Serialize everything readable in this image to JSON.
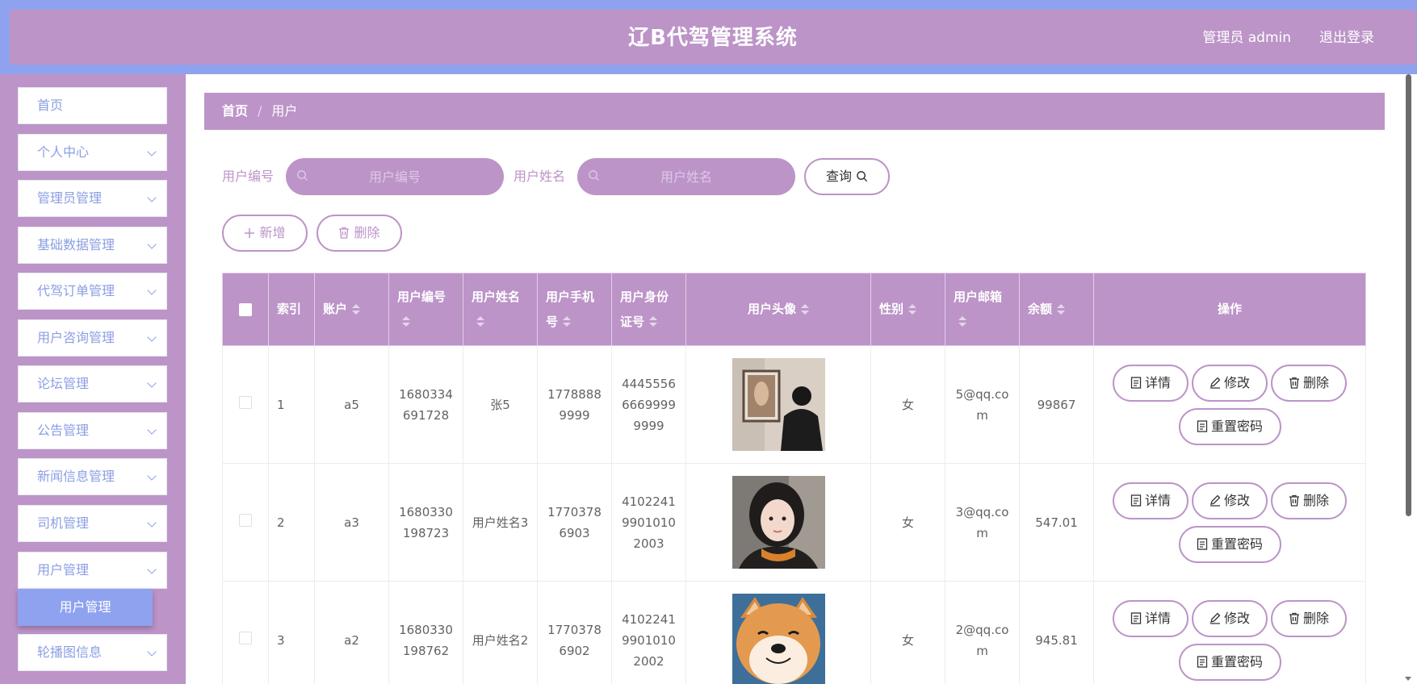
{
  "header": {
    "title": "辽B代驾管理系统",
    "user": "管理员 admin",
    "logout": "退出登录"
  },
  "sidebar": {
    "items": [
      {
        "label": "首页"
      },
      {
        "label": "个人中心"
      },
      {
        "label": "管理员管理"
      },
      {
        "label": "基础数据管理"
      },
      {
        "label": "代驾订单管理"
      },
      {
        "label": "用户咨询管理"
      },
      {
        "label": "论坛管理"
      },
      {
        "label": "公告管理"
      },
      {
        "label": "新闻信息管理"
      },
      {
        "label": "司机管理"
      },
      {
        "label": "用户管理"
      },
      {
        "label": "轮播图信息"
      }
    ],
    "active_sub": "用户管理"
  },
  "breadcrumb": {
    "home": "首页",
    "sep": "/",
    "current": "用户"
  },
  "filters": {
    "user_no_label": "用户编号",
    "user_no_placeholder": "用户编号",
    "user_name_label": "用户姓名",
    "user_name_placeholder": "用户姓名",
    "query": "查询"
  },
  "actions": {
    "add": "新增",
    "delete": "删除"
  },
  "table": {
    "headers": {
      "index": "索引",
      "account": "账户",
      "user_no": "用户编号",
      "name": "用户姓名",
      "phone": "用户手机号",
      "id_card": "用户身份证号",
      "avatar": "用户头像",
      "gender": "性别",
      "email": "用户邮箱",
      "balance": "余额",
      "ops": "操作"
    },
    "rows": [
      {
        "index": "1",
        "account": "a5",
        "user_no": "1680334691728",
        "name": "张5",
        "phone": "17788889999",
        "id_card": "444555666699999999",
        "gender": "女",
        "email": "5@qq.com",
        "balance": "99867",
        "avatar_icon": "photo-person-back"
      },
      {
        "index": "2",
        "account": "a3",
        "user_no": "1680330198723",
        "name": "用户姓名3",
        "phone": "17703786903",
        "id_card": "410224199010102003",
        "gender": "女",
        "email": "3@qq.com",
        "balance": "547.01",
        "avatar_icon": "photo-girl-portrait"
      },
      {
        "index": "3",
        "account": "a2",
        "user_no": "1680330198762",
        "name": "用户姓名2",
        "phone": "17703786902",
        "id_card": "410224199010102002",
        "gender": "女",
        "email": "2@qq.com",
        "balance": "945.81",
        "avatar_icon": "photo-shiba-dog"
      }
    ],
    "row_ops": {
      "detail": "详情",
      "edit": "修改",
      "delete": "删除",
      "reset": "重置密码"
    }
  }
}
